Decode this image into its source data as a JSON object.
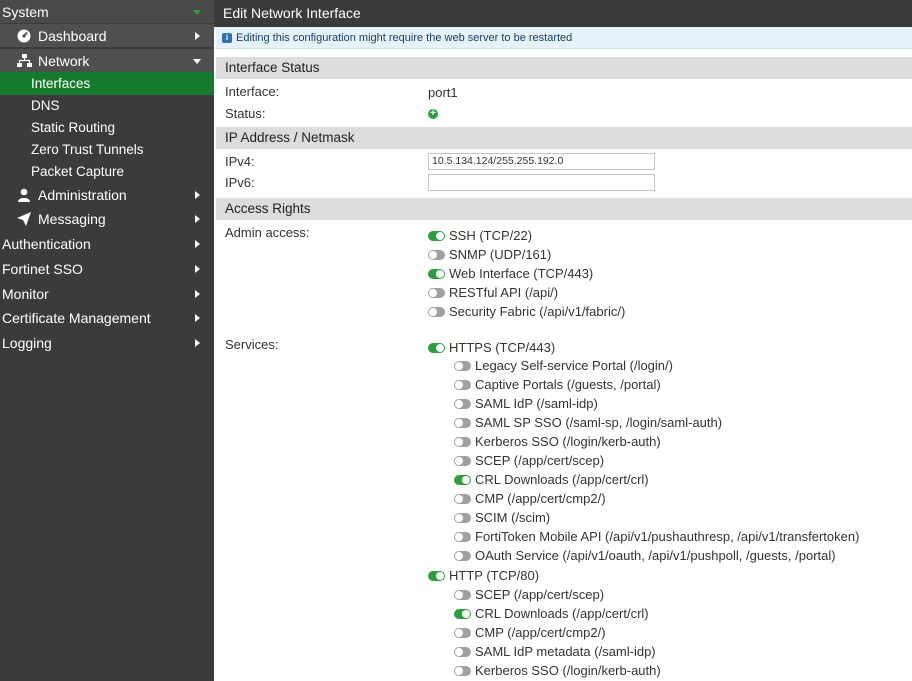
{
  "sidebar": {
    "system": "System",
    "dashboard": "Dashboard",
    "network": "Network",
    "network_items": [
      "Interfaces",
      "DNS",
      "Static Routing",
      "Zero Trust Tunnels",
      "Packet Capture"
    ],
    "administration": "Administration",
    "messaging": "Messaging",
    "top_items": [
      "Authentication",
      "Fortinet SSO",
      "Monitor",
      "Certificate Management",
      "Logging"
    ]
  },
  "page": {
    "title": "Edit Network Interface",
    "notice": "Editing this configuration might require the web server to be restarted"
  },
  "interface_status": {
    "heading": "Interface Status",
    "interface_label": "Interface:",
    "interface_value": "port1",
    "status_label": "Status:",
    "status_icon": "plus-circle-icon"
  },
  "ip": {
    "heading": "IP Address / Netmask",
    "ipv4_label": "IPv4:",
    "ipv4_value": "10.5.134.124/255.255.192.0",
    "ipv6_label": "IPv6:",
    "ipv6_value": ""
  },
  "access": {
    "heading": "Access Rights",
    "admin_label": "Admin access:",
    "admin": [
      {
        "label": "SSH (TCP/22)",
        "on": true
      },
      {
        "label": "SNMP (UDP/161)",
        "on": false
      },
      {
        "label": "Web Interface (TCP/443)",
        "on": true
      },
      {
        "label": "RESTful API (/api/)",
        "on": false
      },
      {
        "label": "Security Fabric (/api/v1/fabric/)",
        "on": false
      }
    ],
    "services_label": "Services:",
    "https": {
      "label": "HTTPS (TCP/443)",
      "on": true
    },
    "https_items": [
      {
        "label": "Legacy Self-service Portal (/login/)",
        "on": false
      },
      {
        "label": "Captive Portals (/guests, /portal)",
        "on": false
      },
      {
        "label": "SAML IdP (/saml-idp)",
        "on": false
      },
      {
        "label": "SAML SP SSO (/saml-sp, /login/saml-auth)",
        "on": false
      },
      {
        "label": "Kerberos SSO (/login/kerb-auth)",
        "on": false
      },
      {
        "label": "SCEP (/app/cert/scep)",
        "on": false
      },
      {
        "label": "CRL Downloads (/app/cert/crl)",
        "on": true
      },
      {
        "label": "CMP (/app/cert/cmp2/)",
        "on": false
      },
      {
        "label": "SCIM (/scim)",
        "on": false
      },
      {
        "label": "FortiToken Mobile API (/api/v1/pushauthresp, /api/v1/transfertoken)",
        "on": false
      },
      {
        "label": "OAuth Service (/api/v1/oauth, /api/v1/pushpoll, /guests, /portal)",
        "on": false
      }
    ],
    "http": {
      "label": "HTTP (TCP/80)",
      "on": true
    },
    "http_items": [
      {
        "label": "SCEP (/app/cert/scep)",
        "on": false
      },
      {
        "label": "CRL Downloads (/app/cert/crl)",
        "on": true
      },
      {
        "label": "CMP (/app/cert/cmp2/)",
        "on": false
      },
      {
        "label": "SAML IdP metadata (/saml-idp)",
        "on": false
      },
      {
        "label": "Kerberos SSO (/login/kerb-auth)",
        "on": false
      }
    ]
  },
  "colors": {
    "accent": "#167a2c",
    "toggle_on": "#2e9e3c",
    "sidebar": "#3b3b3b"
  }
}
